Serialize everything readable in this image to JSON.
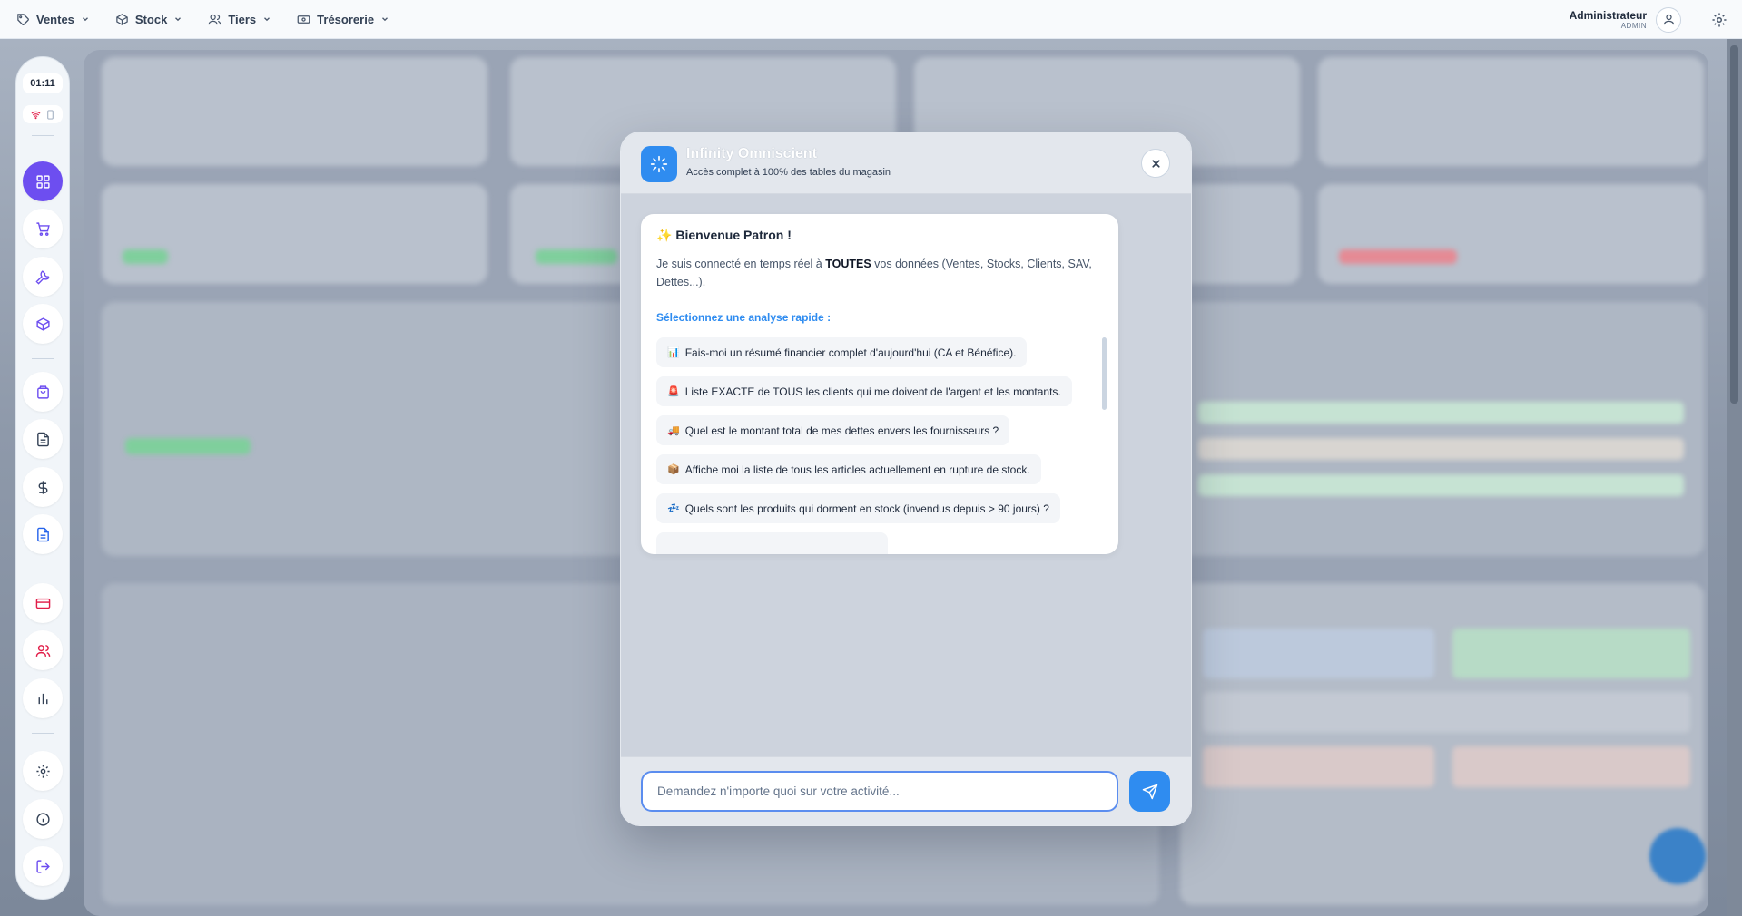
{
  "nav": {
    "items": [
      {
        "label": "Ventes",
        "icon": "tag-icon"
      },
      {
        "label": "Stock",
        "icon": "box-icon"
      },
      {
        "label": "Tiers",
        "icon": "users-icon"
      },
      {
        "label": "Trésorerie",
        "icon": "banknote-icon"
      }
    ]
  },
  "user": {
    "name": "Administrateur",
    "role": "ADMIN"
  },
  "sidebar": {
    "clock": "01:11",
    "active_color": "#6d4ef0"
  },
  "modal": {
    "title": "Infinity Omniscient",
    "subtitle": "Accès complet à 100% des tables du magasin",
    "welcome": {
      "title": "Bienvenue Patron !",
      "title_emoji": "✨",
      "text_before": "Je suis connecté en temps réel à ",
      "text_bold": "TOUTES",
      "text_after": " vos données (Ventes, Stocks, Clients, SAV, Dettes...).",
      "quick_label": "Sélectionnez une analyse rapide :"
    },
    "suggestions": [
      {
        "emoji": "📊",
        "text": "Fais-moi un résumé financier complet d'aujourd'hui (CA et Bénéfice)."
      },
      {
        "emoji": "🚨",
        "text": "Liste EXACTE de TOUS les clients qui me doivent de l'argent et les montants."
      },
      {
        "emoji": "🚚",
        "text": "Quel est le montant total de mes dettes envers les fournisseurs ?"
      },
      {
        "emoji": "📦",
        "text": "Affiche moi la liste de tous les articles actuellement en rupture de stock."
      },
      {
        "emoji": "💤",
        "text": "Quels sont les produits qui dorment en stock (invendus depuis > 90 jours) ?"
      }
    ],
    "input_placeholder": "Demandez n'importe quoi sur votre activité...",
    "accent_color": "#2f8cf0"
  }
}
